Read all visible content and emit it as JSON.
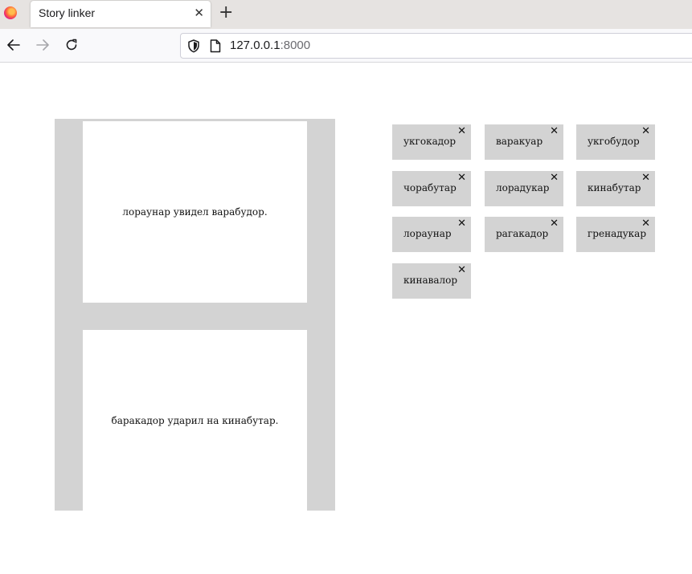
{
  "browser": {
    "tab_title": "Story linker",
    "tab_close": "✕",
    "new_tab": "+",
    "url_host": "127.0.0.1",
    "url_port": ":8000"
  },
  "panels": [
    {
      "text": "лораунар увидел варабудор."
    },
    {
      "text": "баракадор ударил на кинабутар."
    }
  ],
  "words": [
    {
      "label": "укгокадор",
      "remove": "✕"
    },
    {
      "label": "варакуар",
      "remove": "✕"
    },
    {
      "label": "укгобудор",
      "remove": "✕"
    },
    {
      "label": "чорабутар",
      "remove": "✕"
    },
    {
      "label": "лорадукар",
      "remove": "✕"
    },
    {
      "label": "кинабутар",
      "remove": "✕"
    },
    {
      "label": "лораунар",
      "remove": "✕"
    },
    {
      "label": "рагакадор",
      "remove": "✕"
    },
    {
      "label": "гренадукар",
      "remove": "✕"
    },
    {
      "label": "кинавалор",
      "remove": "✕"
    }
  ],
  "colors": {
    "panel_frame": "#d3d3d3",
    "chip_background": "#d3d3d3"
  }
}
